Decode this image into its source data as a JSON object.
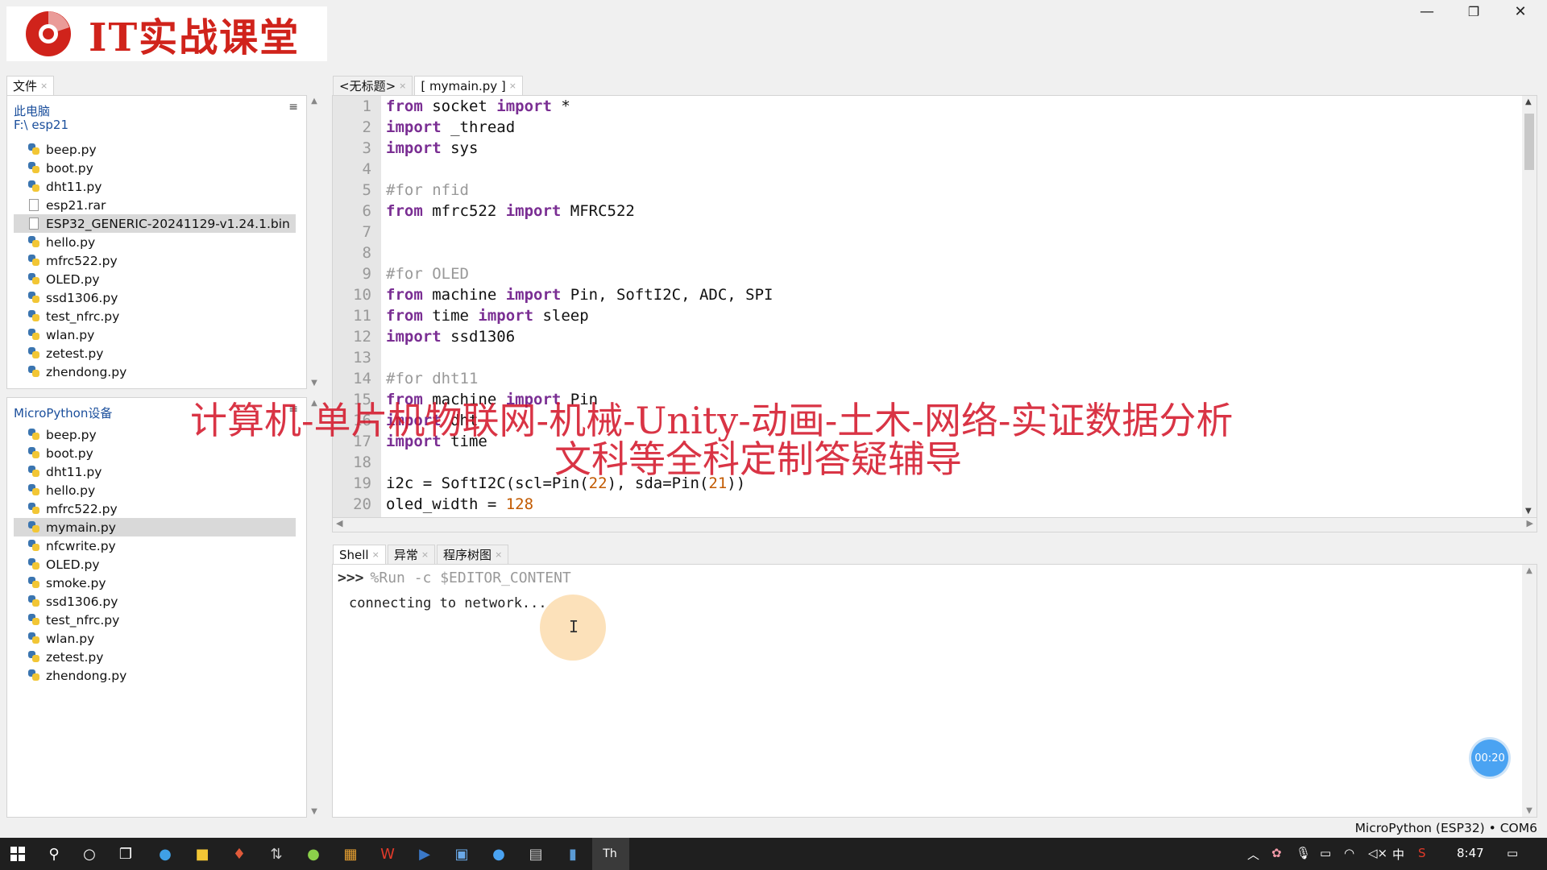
{
  "brand": {
    "logo_text": "IT实战课堂",
    "logo_color": "#d0231b"
  },
  "window_controls": {
    "minimize": "—",
    "maximize": "❐",
    "close": "✕"
  },
  "files_panel": {
    "tab_label": "文件",
    "location_root": "此电脑",
    "location_path": "F:\\ esp21",
    "items": [
      {
        "name": "beep.py",
        "type": "py"
      },
      {
        "name": "boot.py",
        "type": "py"
      },
      {
        "name": "dht11.py",
        "type": "py"
      },
      {
        "name": "esp21.rar",
        "type": "doc"
      },
      {
        "name": "ESP32_GENERIC-20241129-v1.24.1.bin",
        "type": "doc",
        "selected": true
      },
      {
        "name": "hello.py",
        "type": "py"
      },
      {
        "name": "mfrc522.py",
        "type": "py"
      },
      {
        "name": "OLED.py",
        "type": "py"
      },
      {
        "name": "ssd1306.py",
        "type": "py"
      },
      {
        "name": "test_nfrc.py",
        "type": "py"
      },
      {
        "name": "wlan.py",
        "type": "py"
      },
      {
        "name": "zetest.py",
        "type": "py"
      },
      {
        "name": "zhendong.py",
        "type": "py"
      }
    ]
  },
  "device_panel": {
    "title": "MicroPython设备",
    "items": [
      {
        "name": "beep.py",
        "type": "py"
      },
      {
        "name": "boot.py",
        "type": "py"
      },
      {
        "name": "dht11.py",
        "type": "py"
      },
      {
        "name": "hello.py",
        "type": "py"
      },
      {
        "name": "mfrc522.py",
        "type": "py"
      },
      {
        "name": "mymain.py",
        "type": "py",
        "selected": true
      },
      {
        "name": "nfcwrite.py",
        "type": "py"
      },
      {
        "name": "OLED.py",
        "type": "py"
      },
      {
        "name": "smoke.py",
        "type": "py"
      },
      {
        "name": "ssd1306.py",
        "type": "py"
      },
      {
        "name": "test_nfrc.py",
        "type": "py"
      },
      {
        "name": "wlan.py",
        "type": "py"
      },
      {
        "name": "zetest.py",
        "type": "py"
      },
      {
        "name": "zhendong.py",
        "type": "py"
      }
    ]
  },
  "editor": {
    "tabs": [
      {
        "label": "<无标题>",
        "active": false
      },
      {
        "label": "[ mymain.py ]",
        "active": true
      }
    ],
    "lines": [
      [
        [
          "kw",
          "from"
        ],
        [
          "t",
          " socket "
        ],
        [
          "kw",
          "import"
        ],
        [
          "t",
          " *"
        ]
      ],
      [
        [
          "kw",
          "import"
        ],
        [
          "t",
          " _thread"
        ]
      ],
      [
        [
          "kw",
          "import"
        ],
        [
          "t",
          " sys"
        ]
      ],
      [],
      [
        [
          "cm",
          "#for nfid"
        ]
      ],
      [
        [
          "kw",
          "from"
        ],
        [
          "t",
          " mfrc522 "
        ],
        [
          "kw",
          "import"
        ],
        [
          "t",
          " MFRC522"
        ]
      ],
      [],
      [],
      [
        [
          "cm",
          "#for OLED"
        ]
      ],
      [
        [
          "kw",
          "from"
        ],
        [
          "t",
          " machine "
        ],
        [
          "kw",
          "import"
        ],
        [
          "t",
          " Pin, SoftI2C, ADC, SPI"
        ]
      ],
      [
        [
          "kw",
          "from"
        ],
        [
          "t",
          " time "
        ],
        [
          "kw",
          "import"
        ],
        [
          "t",
          " sleep"
        ]
      ],
      [
        [
          "kw",
          "import"
        ],
        [
          "t",
          " ssd1306"
        ]
      ],
      [],
      [
        [
          "cm",
          "#for dht11"
        ]
      ],
      [
        [
          "kw",
          "from"
        ],
        [
          "t",
          " machine "
        ],
        [
          "kw",
          "import"
        ],
        [
          "t",
          " Pin"
        ]
      ],
      [
        [
          "kw",
          "import"
        ],
        [
          "t",
          " dht"
        ]
      ],
      [
        [
          "kw",
          "import"
        ],
        [
          "t",
          " time"
        ]
      ],
      [],
      [
        [
          "t",
          "i2c = SoftI2C(scl=Pin("
        ],
        [
          "nm",
          "22"
        ],
        [
          "t",
          "), sda=Pin("
        ],
        [
          "nm",
          "21"
        ],
        [
          "t",
          "))"
        ]
      ],
      [
        [
          "t",
          "oled_width = "
        ],
        [
          "nm",
          "128"
        ]
      ]
    ]
  },
  "shell": {
    "tabs": [
      {
        "label": "Shell",
        "active": true
      },
      {
        "label": "异常",
        "active": false
      },
      {
        "label": "程序树图",
        "active": false
      }
    ],
    "prompt": ">>>",
    "command": "%Run -c $EDITOR_CONTENT",
    "output": "connecting to network..."
  },
  "timer": "00:20",
  "status_bar": "MicroPython (ESP32)  •  COM6",
  "overlay": {
    "line1": "计算机-单片机物联网-机械-Unity-动画-土木-网络-实证数据分析",
    "line2": "文科等全科定制答疑辅导"
  },
  "taskbar": {
    "clock": "8:47",
    "ime": "中"
  }
}
